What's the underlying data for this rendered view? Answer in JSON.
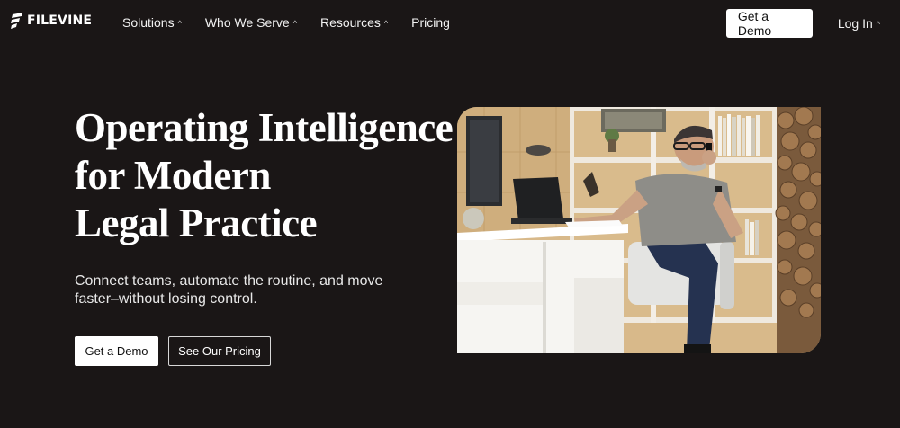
{
  "nav": {
    "logo_text": "FILEVINE",
    "links": [
      {
        "label": "Solutions",
        "has_caret": true
      },
      {
        "label": "Who We Serve",
        "has_caret": true
      },
      {
        "label": "Resources",
        "has_caret": true
      },
      {
        "label": "Pricing",
        "has_caret": false
      }
    ],
    "demo_button": "Get a Demo",
    "login": "Log In"
  },
  "hero": {
    "title_lines": [
      "Operating Intelligence",
      "for Modern",
      "Legal Practice"
    ],
    "subtitle_lines": [
      "Connect teams, automate the routine, and move",
      "faster–without losing control."
    ],
    "primary_cta": "Get a Demo",
    "secondary_cta": "See Our Pricing"
  },
  "colors": {
    "background": "#1a1616",
    "button_bg": "#ffffff",
    "text": "#ffffff"
  },
  "icons": {
    "logo": "filevine-logo-icon",
    "caret": "chevron-up-icon"
  }
}
